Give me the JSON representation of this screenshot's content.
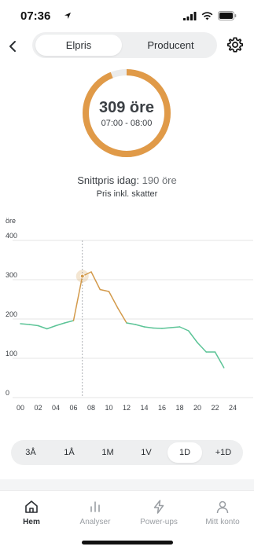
{
  "status_bar": {
    "time": "07:36"
  },
  "nav": {
    "segments": [
      "Elpris",
      "Producent"
    ],
    "active_segment": 0
  },
  "gauge": {
    "value": "309 öre",
    "time_range": "07:00 - 08:00",
    "fill_fraction": 0.94,
    "color": "#e09a48"
  },
  "summary": {
    "avg_label": "Snittpris idag:",
    "avg_value": "190 öre",
    "tax_note": "Pris inkl. skatter"
  },
  "chart_data": {
    "type": "line",
    "ylabel": "öre",
    "ylim": [
      0,
      400
    ],
    "yticks": [
      "0",
      "100",
      "200",
      "300",
      "400"
    ],
    "xlim": [
      0,
      24
    ],
    "xticks": [
      "00",
      "02",
      "04",
      "06",
      "08",
      "10",
      "12",
      "14",
      "16",
      "18",
      "20",
      "22",
      "24"
    ],
    "grid": true,
    "series": [
      {
        "x": [
          0,
          1,
          2,
          3,
          4,
          5,
          6,
          7,
          8,
          9,
          10,
          11,
          12,
          13,
          14,
          15,
          16,
          17,
          18,
          19,
          20,
          21,
          22,
          23
        ],
        "values": [
          188,
          186,
          183,
          175,
          183,
          190,
          196,
          309,
          320,
          275,
          270,
          228,
          190,
          186,
          180,
          177,
          176,
          178,
          180,
          170,
          140,
          116,
          116,
          76
        ]
      }
    ],
    "highlight": {
      "x": 7,
      "y": 309
    },
    "colors": {
      "normal": "#5cc497",
      "high": "#d39a4b",
      "grid": "#e6e6e6"
    },
    "high_threshold": 200
  },
  "ranges": {
    "options": [
      "3Å",
      "1Å",
      "1M",
      "1V",
      "1D",
      "+1D"
    ],
    "active": 4
  },
  "tabs": {
    "items": [
      {
        "label": "Hem",
        "icon": "home-icon"
      },
      {
        "label": "Analyser",
        "icon": "bar-chart-icon"
      },
      {
        "label": "Power-ups",
        "icon": "lightning-icon"
      },
      {
        "label": "Mitt konto",
        "icon": "person-icon"
      }
    ],
    "active": 0
  }
}
